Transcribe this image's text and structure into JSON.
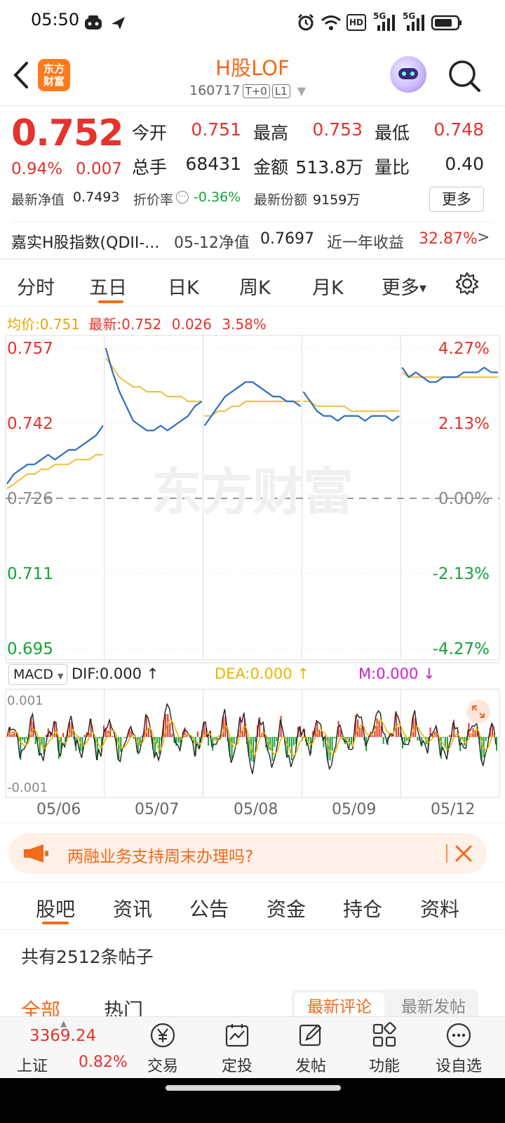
{
  "status_bar": {
    "time": "05:50",
    "net1": "5G",
    "net2": "5G",
    "hd": "HD"
  },
  "header": {
    "logo_line1": "东方",
    "logo_line2": "财富",
    "title": "H股LOF",
    "code": "160717",
    "tag1": "T+0",
    "tag2": "L1"
  },
  "quote": {
    "price": "0.752",
    "change_pct": "0.94%",
    "change_val": "0.007",
    "open_label": "今开",
    "open": "0.751",
    "high_label": "最高",
    "high": "0.753",
    "low_label": "最低",
    "low": "0.748",
    "volume_label": "总手",
    "volume": "68431",
    "amount_label": "金额",
    "amount": "513.8万",
    "vol_ratio_label": "量比",
    "vol_ratio": "0.40",
    "nav_label": "最新净值",
    "nav": "0.7493",
    "premium_label": "折价率",
    "premium": "-0.36%",
    "shares_label": "最新份额",
    "shares": "9159万",
    "more": "更多"
  },
  "fund": {
    "name": "嘉实H股指数(QDII-...",
    "nav_date_label": "05-12净值",
    "nav": "0.7697",
    "year_return_label": "近一年收益",
    "year_return": "32.87%"
  },
  "ktabs": [
    "分时",
    "五日",
    "日K",
    "周K",
    "月K",
    "更多"
  ],
  "ktab_active": "五日",
  "chart_info": {
    "avg_label": "均价:",
    "avg": "0.751",
    "last_label": "最新:",
    "last": "0.752",
    "chg": "0.026",
    "chg_pct": "3.58%"
  },
  "watermark": "东方财富",
  "chart_data": {
    "type": "line",
    "y_left_ticks": [
      "0.757",
      "0.742",
      "0.726",
      "0.711",
      "0.695"
    ],
    "y_right_ticks": [
      "4.27%",
      "2.13%",
      "0.00%",
      "-2.13%",
      "-4.27%"
    ],
    "ylim": [
      0.695,
      0.757
    ],
    "reference": 0.726,
    "dates": [
      "05/06",
      "05/07",
      "05/08",
      "05/09",
      "05/12"
    ],
    "series": [
      {
        "color": "#2d6cc0",
        "values": [
          0.729,
          0.731,
          0.732,
          0.733,
          0.733,
          0.734,
          0.735,
          0.734,
          0.735,
          0.736,
          0.736,
          0.737,
          0.738,
          0.739,
          0.741,
          0.757,
          0.752,
          0.748,
          0.745,
          0.742,
          0.741,
          0.74,
          0.74,
          0.741,
          0.74,
          0.741,
          0.742,
          0.743,
          0.745,
          0.746,
          0.741,
          0.743,
          0.745,
          0.747,
          0.748,
          0.749,
          0.75,
          0.75,
          0.749,
          0.748,
          0.747,
          0.747,
          0.746,
          0.746,
          0.745,
          0.748,
          0.746,
          0.744,
          0.743,
          0.743,
          0.742,
          0.743,
          0.743,
          0.743,
          0.742,
          0.743,
          0.743,
          0.743,
          0.742,
          0.743,
          0.753,
          0.751,
          0.752,
          0.751,
          0.75,
          0.75,
          0.751,
          0.751,
          0.751,
          0.752,
          0.752,
          0.752,
          0.753,
          0.752,
          0.752
        ]
      },
      {
        "color": "#f0c24a",
        "values": [
          0.728,
          0.729,
          0.73,
          0.731,
          0.731,
          0.732,
          0.732,
          0.733,
          0.733,
          0.733,
          0.734,
          0.734,
          0.734,
          0.735,
          0.735,
          0.755,
          0.753,
          0.751,
          0.75,
          0.749,
          0.749,
          0.748,
          0.748,
          0.748,
          0.747,
          0.747,
          0.747,
          0.746,
          0.746,
          0.746,
          0.743,
          0.743,
          0.744,
          0.744,
          0.745,
          0.745,
          0.746,
          0.746,
          0.746,
          0.746,
          0.746,
          0.746,
          0.746,
          0.746,
          0.746,
          0.746,
          0.746,
          0.745,
          0.745,
          0.745,
          0.745,
          0.745,
          0.744,
          0.744,
          0.744,
          0.744,
          0.744,
          0.744,
          0.744,
          0.744,
          0.752,
          0.751,
          0.751,
          0.751,
          0.751,
          0.751,
          0.751,
          0.751,
          0.751,
          0.751,
          0.751,
          0.751,
          0.751,
          0.751,
          0.751
        ]
      }
    ]
  },
  "macd": {
    "selector": "MACD",
    "dif_label": "DIF:0.000",
    "dea_label": "DEA:0.000",
    "m_label": "M:0.000",
    "top_tick": "0.001",
    "bottom_tick": "-0.001",
    "colors": {
      "dif": "#222222",
      "dea": "#e8b400",
      "m": "#cc22cc",
      "up": "#e5322d",
      "down": "#13a33a"
    }
  },
  "banner": {
    "text": "两融业务支持周末办理吗?"
  },
  "forum_tabs": [
    "股吧",
    "资讯",
    "公告",
    "资金",
    "持仓",
    "资料"
  ],
  "forum_active": "股吧",
  "post_count": "共有2512条帖子",
  "sub_tabs": {
    "all": "全部",
    "hot": "热门",
    "latest_comment": "最新评论",
    "latest_post": "最新发帖"
  },
  "bottom_nav": {
    "index_value": "3369.24",
    "index_name": "上证",
    "index_pct": "0.82%",
    "items": [
      "交易",
      "定投",
      "发帖",
      "功能",
      "设自选"
    ]
  },
  "colors": {
    "accent": "#f26a1b",
    "up": "#e5322d",
    "down": "#13a33a"
  }
}
